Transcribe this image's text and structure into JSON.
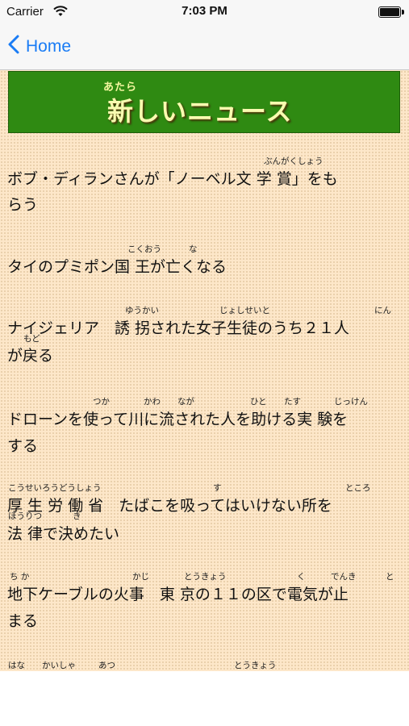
{
  "status_bar": {
    "carrier": "Carrier",
    "time": "7:03 PM"
  },
  "nav": {
    "back_label": "Home"
  },
  "banner": {
    "ruby": "あたら",
    "title": "新しいニュース"
  },
  "headlines": [
    {
      "line1": "ボブ・ディランさんが「ノーベル文 学 賞」をも",
      "line2": "らう",
      "furigana": [
        "ぶんがくしょう"
      ]
    },
    {
      "line1": "タイのプミポン国 王が亡くなる",
      "line2": "",
      "furigana": [
        "こくおう",
        "な"
      ]
    },
    {
      "line1": "ナイジェリア　誘 拐された女子生徒のうち２１人",
      "line2": "が戻る",
      "furigana": [
        "ゆうかい",
        "じょしせいと",
        "にん",
        "もど"
      ]
    },
    {
      "line1": "ドローンを使って川に流された人を助ける実 験を",
      "line2": "する",
      "furigana": [
        "つか",
        "かわ",
        "なが",
        "ひと",
        "たす",
        "じっけん"
      ]
    },
    {
      "line1": "厚 生 労 働 省　たばこを吸ってはいけない所を",
      "line2": "法 律で決めたい",
      "furigana": [
        "こうせいろうどうしょう",
        "す",
        "ところ",
        "ほうりつ",
        "き"
      ]
    },
    {
      "line1": "地下ケーブルの火事　東 京の１１の区で電気が止",
      "line2": "まる",
      "furigana": [
        "ち か",
        "かじ",
        "とうきょう",
        "く",
        "でんき",
        "と"
      ]
    },
    {
      "line1": "",
      "line2": "",
      "furigana": [
        "はな",
        "かいしゃ",
        "あつ",
        "とうきょう"
      ]
    }
  ]
}
